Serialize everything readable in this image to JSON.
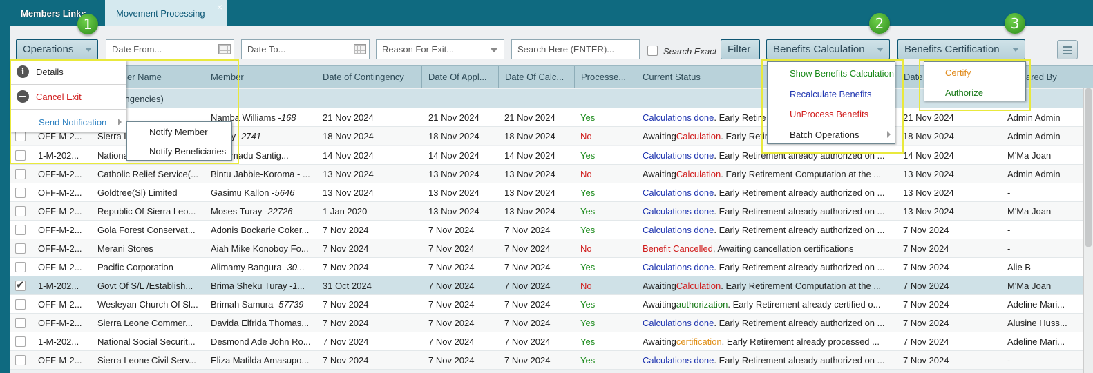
{
  "tabs": [
    {
      "label": "Members Links",
      "active": true
    },
    {
      "label": "Movement Processing",
      "active": false,
      "close": "×"
    }
  ],
  "toolbar": {
    "operations_label": "Operations",
    "date_from_placeholder": "Date From...",
    "date_to_placeholder": "Date To...",
    "reason_placeholder": "Reason For Exit...",
    "search_placeholder": "Search Here (ENTER)...",
    "search_exact_label": "Search Exact",
    "filter_label": "Filter",
    "benefits_calc_label": "Benefits Calculation",
    "benefits_cert_label": "Benefits Certification"
  },
  "grid": {
    "headers": [
      "er Name",
      "Member",
      "Date of Contingency",
      "Date Of Appl...",
      "Date Of Calc...",
      "Processe...",
      "Current Status",
      "Date",
      "ared By"
    ],
    "group_label": "tingencies)",
    "rows": [
      {
        "code": "",
        "employer": "",
        "member": "Namba Williams - ",
        "member_num": "168",
        "contingency": "21 Nov 2024",
        "applied": "21 Nov 2024",
        "calc": "21 Nov 2024",
        "processed": "Yes",
        "status_pre": "",
        "status_kw": "Calculations done",
        "status_kw_color": "blue",
        "status_post": ". Early Retire",
        "date": "21 Nov 2024",
        "prepared_by": "Admin Admin",
        "checked": false
      },
      {
        "code": "OFF-M-2...",
        "employer": "Sierra L",
        "member": "Sesay - ",
        "member_num": "2741",
        "contingency": "18 Nov 2024",
        "applied": "18 Nov 2024",
        "calc": "18 Nov 2024",
        "processed": "No",
        "status_pre": "Awaiting ",
        "status_kw": "Calculation",
        "status_kw_color": "red",
        "status_post": ". Early Retire",
        "date": "18 Nov 2024",
        "prepared_by": "Admin Admin",
        "checked": false
      },
      {
        "code": "1-M-202...",
        "employer": "Nationa",
        "member": "uel Amadu Santig...",
        "member_num": "",
        "contingency": "14 Nov 2024",
        "applied": "14 Nov 2024",
        "calc": "14 Nov 2024",
        "processed": "Yes",
        "status_pre": "",
        "status_kw": "Calculations done",
        "status_kw_color": "blue",
        "status_post": ". Early Retirement already authorized on ...",
        "date": "14 Nov 2024",
        "prepared_by": "M'Ma Joan",
        "checked": false
      },
      {
        "code": "OFF-M-2...",
        "employer": "Catholic Relief Service(...",
        "member": "Bintu Jabbie-Koroma - ...",
        "member_num": "",
        "contingency": "13 Nov 2024",
        "applied": "13 Nov 2024",
        "calc": "13 Nov 2024",
        "processed": "No",
        "status_pre": "Awaiting ",
        "status_kw": "Calculation",
        "status_kw_color": "red",
        "status_post": ". Early Retirement Computation at the ...",
        "date": "13 Nov 2024",
        "prepared_by": "Admin Admin",
        "checked": false
      },
      {
        "code": "OFF-M-2...",
        "employer": "Goldtree(Sl) Limited",
        "member": "Gasimu Kallon - ",
        "member_num": "5646",
        "contingency": "13 Nov 2024",
        "applied": "13 Nov 2024",
        "calc": "13 Nov 2024",
        "processed": "Yes",
        "status_pre": "",
        "status_kw": "Calculations done",
        "status_kw_color": "blue",
        "status_post": ". Early Retirement already authorized on ...",
        "date": "13 Nov 2024",
        "prepared_by": "-",
        "checked": false
      },
      {
        "code": "OFF-M-2...",
        "employer": "Republic Of Sierra Leo...",
        "member": "Moses Turay - ",
        "member_num": "22726",
        "contingency": "1 Jan 2020",
        "applied": "13 Nov 2024",
        "calc": "13 Nov 2024",
        "processed": "Yes",
        "status_pre": "",
        "status_kw": "Calculations done",
        "status_kw_color": "blue",
        "status_post": ". Early Retirement already authorized on ...",
        "date": "13 Nov 2024",
        "prepared_by": "M'Ma Joan",
        "checked": false
      },
      {
        "code": "OFF-M-2...",
        "employer": "Gola Forest Conservat...",
        "member": "Adonis Bockarie Coker...",
        "member_num": "",
        "contingency": "7 Nov 2024",
        "applied": "7 Nov 2024",
        "calc": "7 Nov 2024",
        "processed": "Yes",
        "status_pre": "",
        "status_kw": "Calculations done",
        "status_kw_color": "blue",
        "status_post": ". Early Retirement already authorized on ...",
        "date": "7 Nov 2024",
        "prepared_by": "-",
        "checked": false
      },
      {
        "code": "OFF-M-2...",
        "employer": "Merani Stores",
        "member": "Aiah Mike Konoboy Fo...",
        "member_num": "",
        "contingency": "7 Nov 2024",
        "applied": "7 Nov 2024",
        "calc": "7 Nov 2024",
        "processed": "No",
        "status_pre": "",
        "status_kw": "Benefit Cancelled",
        "status_kw_color": "red",
        "status_post": ", Awaiting cancellation certifications",
        "date": "7 Nov 2024",
        "prepared_by": "-",
        "checked": false
      },
      {
        "code": "OFF-M-2...",
        "employer": "Pacific Corporation",
        "member": "Alimamy Bangura - ",
        "member_num": "30...",
        "contingency": "7 Nov 2024",
        "applied": "7 Nov 2024",
        "calc": "7 Nov 2024",
        "processed": "Yes",
        "status_pre": "",
        "status_kw": "Calculations done",
        "status_kw_color": "blue",
        "status_post": ". Early Retirement already authorized on ...",
        "date": "7 Nov 2024",
        "prepared_by": "Alie B",
        "checked": false
      },
      {
        "code": "1-M-202...",
        "employer": "Govt Of S/L /Establish...",
        "member": "Brima Sheku Turay - ",
        "member_num": "1...",
        "contingency": "31 Oct 2024",
        "applied": "7 Nov 2024",
        "calc": "7 Nov 2024",
        "processed": "No",
        "status_pre": "Awaiting ",
        "status_kw": "Calculation",
        "status_kw_color": "red",
        "status_post": ". Early Retirement Computation at the ...",
        "date": "7 Nov 2024",
        "prepared_by": "M'Ma Joan",
        "checked": true
      },
      {
        "code": "OFF-M-2...",
        "employer": "Wesleyan Church Of Sl...",
        "member": "Brimah Samura - ",
        "member_num": "57739",
        "contingency": "7 Nov 2024",
        "applied": "7 Nov 2024",
        "calc": "7 Nov 2024",
        "processed": "Yes",
        "status_pre": "Awaiting ",
        "status_kw": "authorization",
        "status_kw_color": "green",
        "status_post": ". Early Retirement already certified o...",
        "date": "7 Nov 2024",
        "prepared_by": "Adeline Mari...",
        "checked": false
      },
      {
        "code": "OFF-M-2...",
        "employer": "Sierra Leone Commer...",
        "member": "Davida Elfrida Thomas...",
        "member_num": "",
        "contingency": "7 Nov 2024",
        "applied": "7 Nov 2024",
        "calc": "7 Nov 2024",
        "processed": "Yes",
        "status_pre": "",
        "status_kw": "Calculations done",
        "status_kw_color": "blue",
        "status_post": ". Early Retirement already authorized on ...",
        "date": "7 Nov 2024",
        "prepared_by": "Alusine Huss...",
        "checked": false
      },
      {
        "code": "1-M-202...",
        "employer": "National Social Securit...",
        "member": "Desmond Ade John Ro...",
        "member_num": "",
        "contingency": "7 Nov 2024",
        "applied": "7 Nov 2024",
        "calc": "7 Nov 2024",
        "processed": "Yes",
        "status_pre": "Awaiting ",
        "status_kw": "certification",
        "status_kw_color": "orange",
        "status_post": ". Early Retirement already processed ...",
        "date": "7 Nov 2024",
        "prepared_by": "Adeline Mari...",
        "checked": false
      },
      {
        "code": "OFF-M-2...",
        "employer": "Sierra Leone Civil Serv...",
        "member": "Eliza Matilda Amasupo...",
        "member_num": "",
        "contingency": "7 Nov 2024",
        "applied": "7 Nov 2024",
        "calc": "7 Nov 2024",
        "processed": "Yes",
        "status_pre": "",
        "status_kw": "Calculations done",
        "status_kw_color": "blue",
        "status_post": ". Early Retirement already authorized on ...",
        "date": "7 Nov 2024",
        "prepared_by": "-",
        "checked": false
      }
    ]
  },
  "operations_menu": {
    "details": "Details",
    "cancel_exit": "Cancel Exit",
    "send_notification": "Send Notification",
    "notify_member": "Notify Member",
    "notify_beneficiaries": "Notify Beneficiaries",
    "info_icon_glyph": "i"
  },
  "benefits_calc_menu": {
    "show": "Show Benefits Calculation",
    "recalculate": "Recalculate Benefits",
    "unprocess": "UnProcess Benefits",
    "batch": "Batch Operations"
  },
  "benefits_cert_menu": {
    "certify": "Certify",
    "authorize": "Authorize"
  },
  "callouts": [
    "1",
    "2",
    "3"
  ],
  "colors": {
    "tab_bar": "#0f6a80",
    "header": "#b9d2da",
    "yes": "#1a8a1a",
    "no": "#d01c1c",
    "status_blue": "#1f35b0",
    "highlight": "#e9e93c",
    "callout_badge": "#3aa52a"
  }
}
